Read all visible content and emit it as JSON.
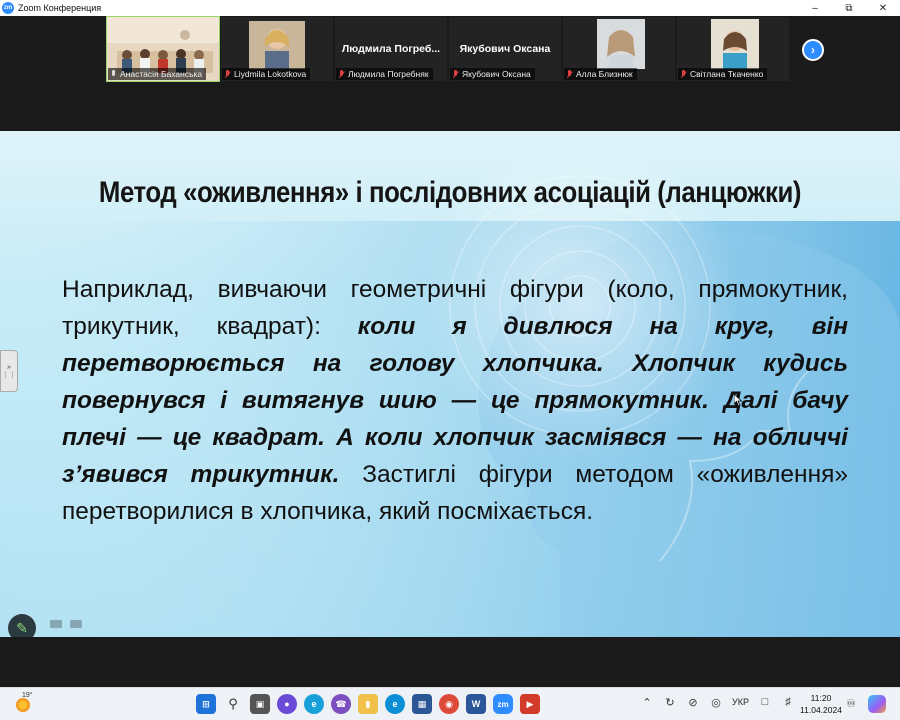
{
  "window": {
    "title": "Zoom Конференция",
    "app_icon_text": "zm"
  },
  "participants": [
    {
      "name": "Анастасія Баханська",
      "muted": false,
      "video": true,
      "active": true
    },
    {
      "name": "Liydmila Lokotkova",
      "muted": true,
      "video": true
    },
    {
      "name": "Людмила Погребняк",
      "display_name": "Людмила Погреб...",
      "muted": true,
      "video": false
    },
    {
      "name": "Якубович Оксана",
      "display_name": "Якубович Оксана",
      "muted": true,
      "video": false
    },
    {
      "name": "Алла Близнюк",
      "muted": true,
      "video": true
    },
    {
      "name": "Світлана Ткаченко",
      "muted": true,
      "video": true
    }
  ],
  "slide": {
    "title": "Метод «оживлення» і послідовних асоціацій (ланцюжки)",
    "text_plain_1": "Наприклад, вивчаючи геометричні фігури (коло, прямокутник, трикутник, квадрат): ",
    "text_italic": "коли я дивлюся на круг, він перетворюється на голову хлопчика. Хлопчик кудись повернувся і витягнув шию — це прямокутник. Далі бачу плечі — це квадрат. А коли хлопчик засміявся — на обличчі з’явився трикутник.",
    "text_plain_2": " Застиглі фігури методом «оживлення» перетворилися в хлопчика, який посміхається."
  },
  "taskbar": {
    "weather_temp": "19°",
    "language": "УКР",
    "time": "11:20",
    "date": "11.04.2024"
  },
  "colors": {
    "zoom_blue": "#2d8cff",
    "active_border": "#9bd46a",
    "muted_red": "#e04040"
  }
}
